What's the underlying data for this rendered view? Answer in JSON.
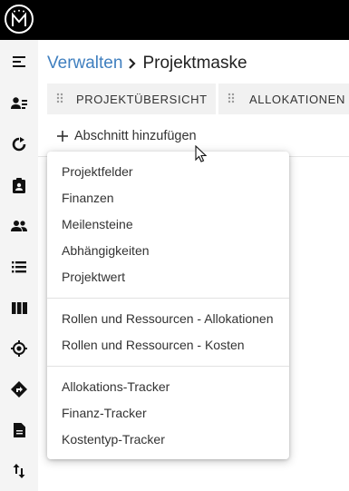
{
  "app": {
    "logo_text": "M"
  },
  "sidebar": {
    "items": [
      {
        "icon": "menu-collapse-icon"
      },
      {
        "icon": "user-list-icon"
      },
      {
        "icon": "refresh-icon"
      },
      {
        "icon": "clipboard-user-icon"
      },
      {
        "icon": "people-icon"
      },
      {
        "icon": "list-icon"
      },
      {
        "icon": "columns-icon"
      },
      {
        "icon": "target-icon"
      },
      {
        "icon": "directions-icon"
      },
      {
        "icon": "document-icon"
      },
      {
        "icon": "sort-arrows-icon"
      }
    ]
  },
  "breadcrumb": {
    "parent": "Verwalten",
    "current": "Projektmaske"
  },
  "tabs": [
    {
      "label": "PROJEKTÜBERSICHT"
    },
    {
      "label": "ALLOKATIONEN"
    }
  ],
  "add_section": {
    "label": "Abschnitt hinzufügen"
  },
  "menu": {
    "groups": [
      [
        "Projektfelder",
        "Finanzen",
        "Meilensteine",
        "Abhängigkeiten",
        "Projektwert"
      ],
      [
        "Rollen und Ressourcen - Allokationen",
        "Rollen und Ressourcen - Kosten"
      ],
      [
        "Allokations-Tracker",
        "Finanz-Tracker",
        "Kostentyp-Tracker"
      ]
    ]
  },
  "colors": {
    "topbar": "#000000",
    "sidebar": "#f4f4f4",
    "link": "#3f7fbf",
    "tab_bg": "#f1f1f1"
  }
}
